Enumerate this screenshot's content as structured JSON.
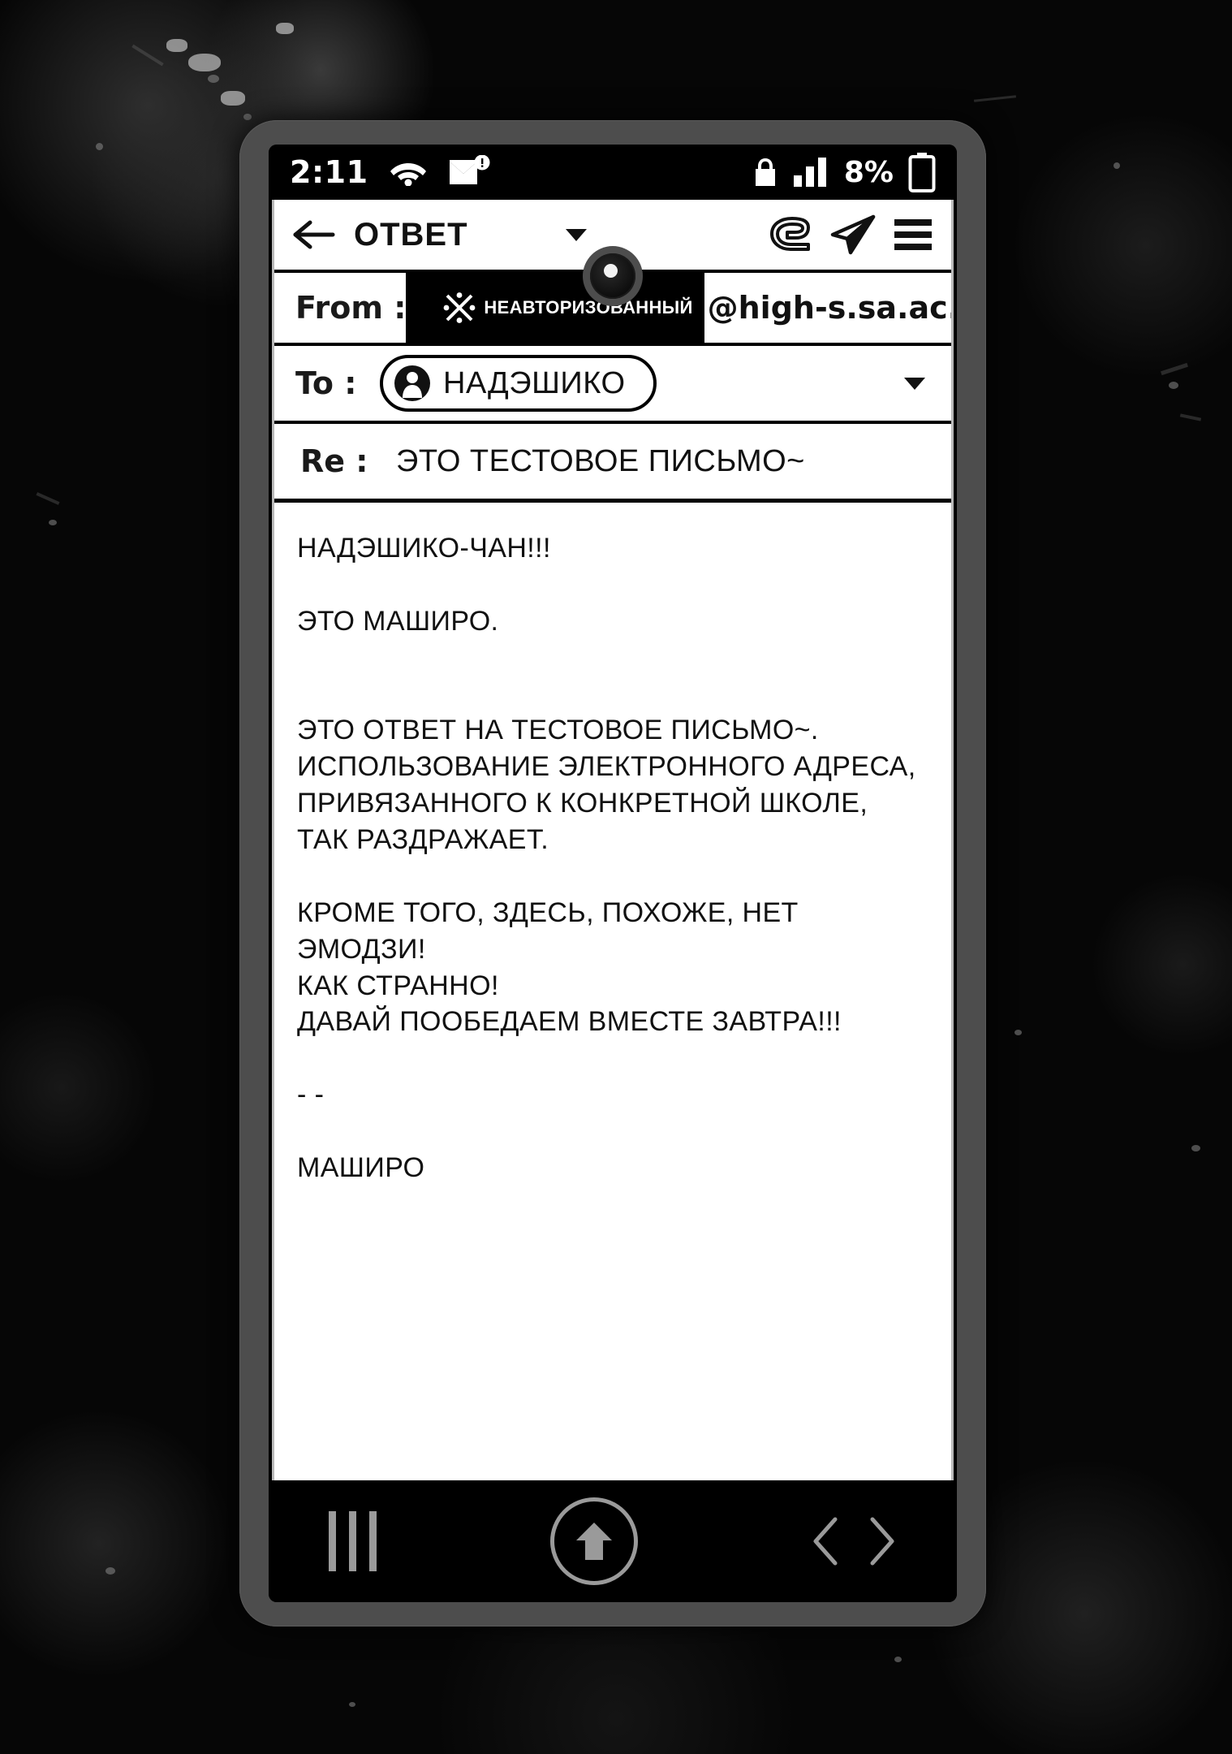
{
  "status_bar": {
    "time": "2:11",
    "battery_percent": "8%",
    "icons": [
      "wifi-icon",
      "mail-notification-icon",
      "lock-icon",
      "signal-bars-icon",
      "battery-icon"
    ]
  },
  "app_bar": {
    "back_label": "back-arrow-icon",
    "title": "ОТВЕТ",
    "dropdown": "chevron-down-icon",
    "attach_label": "attachment-icon",
    "send_label": "send-icon",
    "menu_label": "hamburger-menu-icon"
  },
  "compose": {
    "from": {
      "label": "From :",
      "redacted_text": "НЕАВТОРИЗОВАННЫЙ",
      "domain": "@high-s.sa.ac.jp"
    },
    "to": {
      "label": "To :",
      "recipient": "НАДЭШИКО"
    },
    "subject": {
      "label": "Re :",
      "value": "ЭТО ТЕСТОВОЕ ПИСЬМО~"
    }
  },
  "body": {
    "lines": [
      "НАДЭШИКО-ЧАН!!!",
      "",
      "ЭТО МАШИРО.",
      "",
      "",
      "ЭТО ОТВЕТ НА ТЕСТОВОЕ ПИСЬМО~.",
      "ИСПОЛЬЗОВАНИЕ ЭЛЕКТРОННОГО АДРЕСА,",
      "ПРИВЯЗАННОГО К КОНКРЕТНОЙ ШКОЛЕ,",
      "ТАК РАЗДРАЖАЕТ.",
      "",
      "КРОМЕ ТОГО, ЗДЕСЬ, ПОХОЖЕ, НЕТ",
      "ЭМОДЗИ!",
      "КАК СТРАННО!",
      "ДАВАЙ ПООБЕДАЕМ ВМЕСТЕ ЗАВТРА!!!",
      "",
      "- -",
      "",
      "МАШИРО"
    ],
    "text": "НАДЭШИКО-ЧАН!!!\n\nЭТО МАШИРО.\n\n\nЭТО ОТВЕТ НА ТЕСТОВОЕ ПИСЬМО~.\nИСПОЛЬЗОВАНИЕ ЭЛЕКТРОННОГО АДРЕСА,\nПРИВЯЗАННОГО К КОНКРЕТНОЙ ШКОЛЕ,\nТАК РАЗДРАЖАЕТ.\n\nКРОМЕ ТОГО, ЗДЕСЬ, ПОХОЖЕ, НЕТ\nЭМОДЗИ!\nКАК СТРАННО!\nДАВАЙ ПООБЕДАЕМ ВМЕСТЕ ЗАВТРА!!!\n\n- -\n\nМАШИРО"
  },
  "nav_bar": {
    "recents": "recents-icon",
    "home": "home-up-arrow-icon",
    "back_forward": "prev-next-chevrons-icon"
  },
  "colors": {
    "screen_background": "#000000",
    "sheet_background": "#ffffff",
    "phone_frame": "#4d4d4d",
    "text": "#111111",
    "nav_icon": "#9a9a9a"
  }
}
